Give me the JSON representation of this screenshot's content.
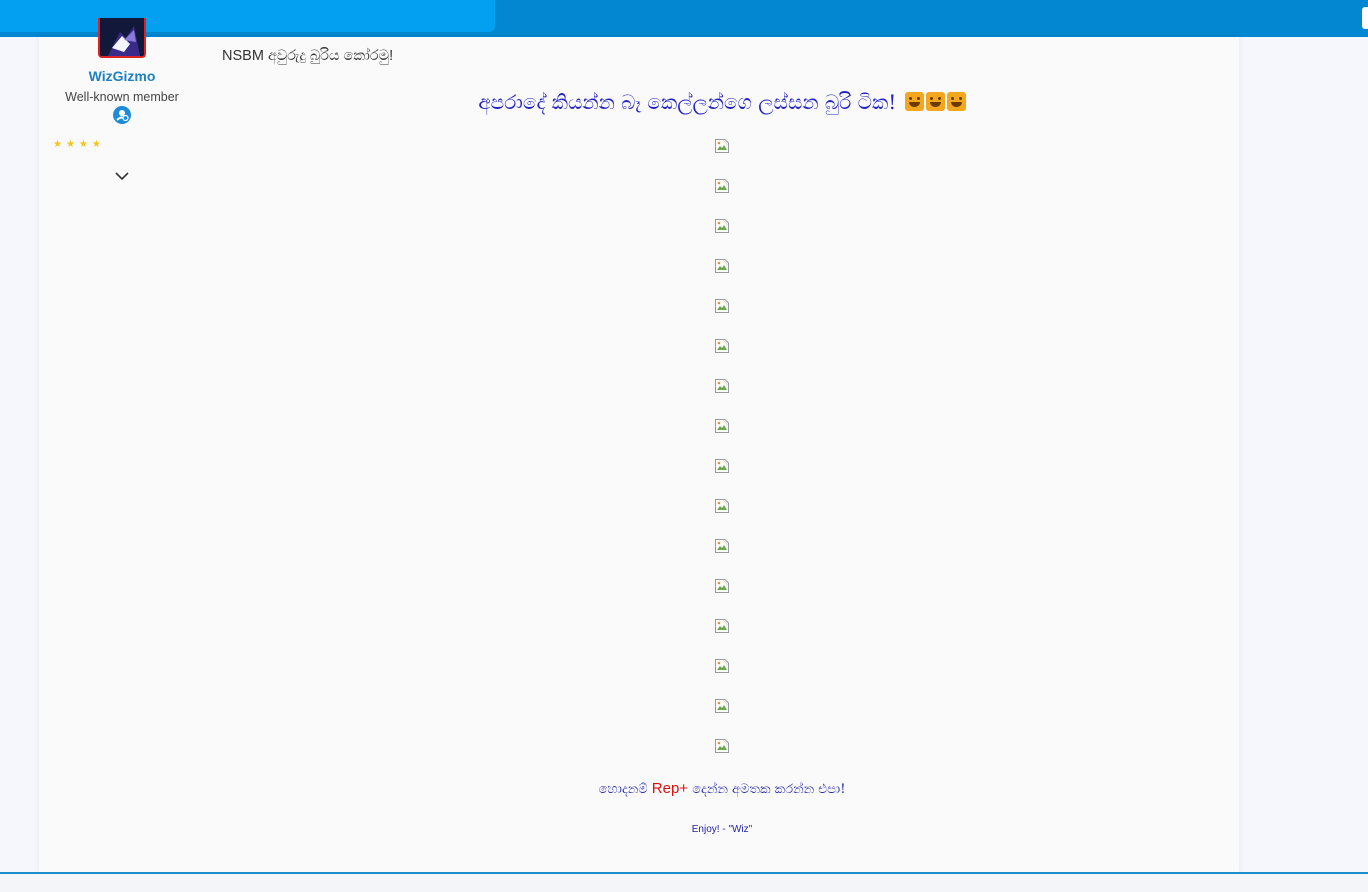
{
  "user": {
    "name": "WizGizmo",
    "title": "Well-known member",
    "stars": "★★★★"
  },
  "post": {
    "title_prefix": "NSBM",
    "title_suffix": "අවුරුදු බුරිය කෝරමු!",
    "headline": "අපරාදේ කියන්න බෑ කෙල්ලන්ගෙ ලස්සන බුරි ටික!",
    "images": [
      "",
      "",
      "",
      "",
      "",
      "",
      "",
      "",
      "",
      "",
      "",
      "",
      "",
      "",
      "",
      ""
    ],
    "rep_before": "හොදනම්",
    "rep_label": "Rep+",
    "rep_after": "දෙන්න අමතක කරන්න එපා!",
    "signature": "Enjoy! - \"Wiz\""
  },
  "colors": {
    "header": "#0287d0",
    "header_left": "#039ff0",
    "headline": "#2222c8",
    "rep": "#e01010",
    "username": "#1e81c4"
  },
  "icons": {
    "badge": "user-badge-icon",
    "chevron": "chevron-down-icon",
    "broken": "broken-image-icon",
    "emoji": "heart-eyes-emoji-icon"
  }
}
